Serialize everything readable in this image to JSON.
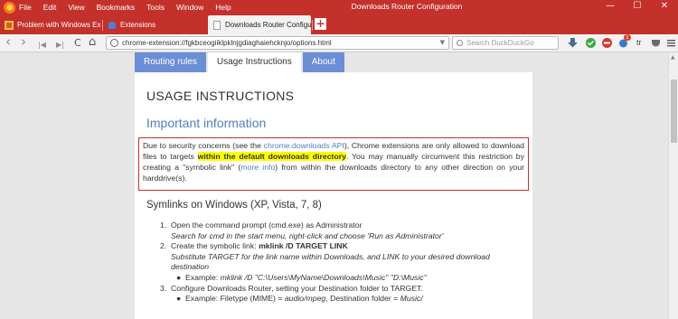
{
  "window": {
    "title": "Downloads Router Configuration",
    "menu": [
      "File",
      "Edit",
      "View",
      "Bookmarks",
      "Tools",
      "Window",
      "Help"
    ],
    "controls": {
      "minimize": "—",
      "maximize": "☐",
      "close": "✕"
    }
  },
  "tabs": [
    {
      "label": "Problem with Windows Expl",
      "active": false
    },
    {
      "label": "Extensions",
      "active": false
    },
    {
      "label": "Downloads Router Configur",
      "active": true
    }
  ],
  "newtab_label": "+",
  "nav": {
    "back": "‹",
    "forward": "›",
    "first": "|◀",
    "last": "▶|",
    "reload": "C",
    "home": "⌂",
    "url": "chrome-extension://fgkbceogiiklpklnjgdiaghaiehcknjo/options.html",
    "search_placeholder": "Search DuckDuckGo",
    "badge_count": "1",
    "translate_label": "tr"
  },
  "options": {
    "tabs": [
      "Routing rules",
      "Usage Instructions",
      "About"
    ],
    "active_tab": "Usage Instructions"
  },
  "content": {
    "heading": "USAGE INSTRUCTIONS",
    "important_heading": "Important information",
    "para": {
      "p1": "Due to security concerns (see the ",
      "link1": "chrome.downloads API",
      "p2": "), Chrome extensions are only allowed to download files to targets ",
      "highlight": "within the default downloads directory",
      "p3": ". You may manually circumvent this restriction by creating a \"symbolic link\" (",
      "link2": "more info",
      "p4": ") from within the downloads directory to any other direction on your harddrive(s)."
    },
    "symlinks_heading": "Symlinks on Windows (XP, Vista, 7, 8)",
    "step1": {
      "num": "1.",
      "text": "Open the command prompt (cmd.exe) as Administrator",
      "sub": "Search for cmd in the start menu, right-click and choose 'Run as Administrator'"
    },
    "step2": {
      "num": "2.",
      "text": "Create the symbolic link: ",
      "cmd": "mklink /D TARGET LINK",
      "sub": "Substitute TARGET for the link name within Downloads, and LINK to your desired download destination",
      "example_label": "Example: ",
      "example": "mklink /D \"C:\\Users\\MyName\\Downloads\\Music\" \"D:\\Music\""
    },
    "step3": {
      "num": "3.",
      "text": "Configure Downloads Router, setting your Destination folder to TARGET.",
      "example_label": "Example: Filetype (MIME) = ",
      "mime": "audio/mpeg",
      "mid": ", Destination folder = ",
      "folder": "Music/"
    }
  }
}
